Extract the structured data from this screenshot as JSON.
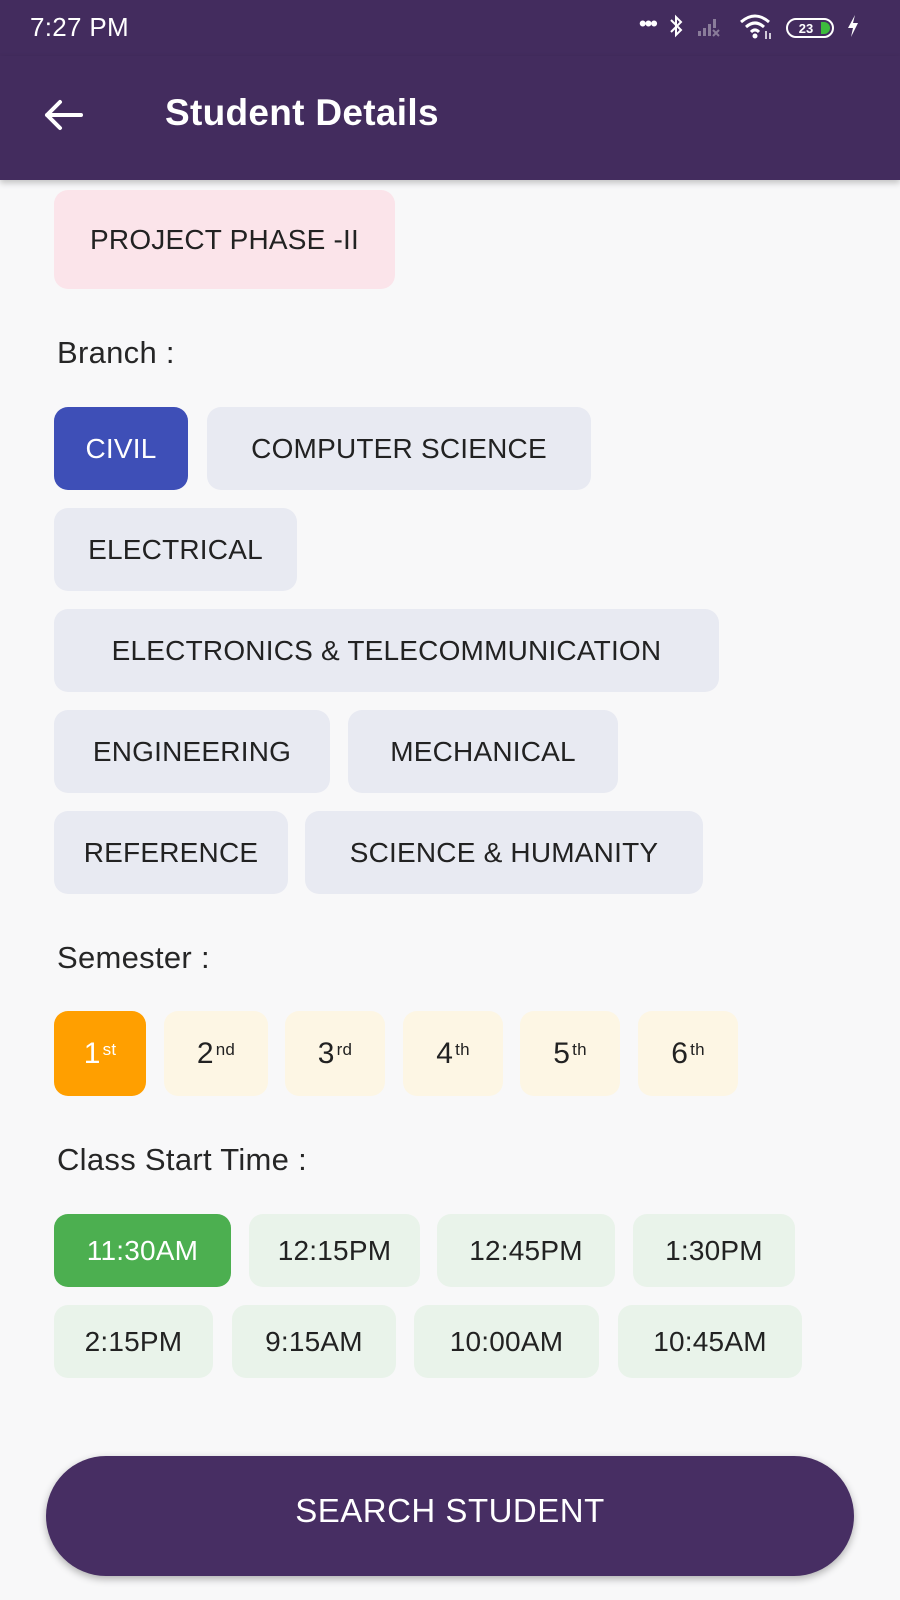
{
  "status_bar": {
    "time": "7:27 PM",
    "battery_level": "23",
    "icons": [
      "more-dots-icon",
      "bluetooth-icon",
      "signal-icon",
      "wifi-icon",
      "battery-icon",
      "charging-icon"
    ]
  },
  "app_bar": {
    "title": "Student Details",
    "back_icon": "arrow-left-icon"
  },
  "subject": {
    "label": "PROJECT PHASE -II"
  },
  "branch": {
    "label": "Branch :",
    "selected": "CIVIL",
    "options": [
      "CIVIL",
      "COMPUTER SCIENCE",
      "ELECTRICAL",
      "ELECTRONICS & TELECOMMUNICATION",
      "ENGINEERING",
      "MECHANICAL",
      "REFERENCE",
      "SCIENCE & HUMANITY"
    ]
  },
  "semester": {
    "label": "Semester :",
    "selected": "1st",
    "options": [
      {
        "num": "1",
        "suffix": "st"
      },
      {
        "num": "2",
        "suffix": "nd"
      },
      {
        "num": "3",
        "suffix": "rd"
      },
      {
        "num": "4",
        "suffix": "th"
      },
      {
        "num": "5",
        "suffix": "th"
      },
      {
        "num": "6",
        "suffix": "th"
      }
    ]
  },
  "class_time": {
    "label": "Class Start Time :",
    "selected": "11:30AM",
    "options": [
      "11:30AM",
      "12:15PM",
      "12:45PM",
      "1:30PM",
      "2:15PM",
      "9:15AM",
      "10:00AM",
      "10:45AM"
    ]
  },
  "search_button": {
    "label": "SEARCH STUDENT"
  },
  "colors": {
    "app_bar": "#432c5e",
    "branch_selected": "#3e4fb7",
    "semester_selected": "#ff9f00",
    "time_selected": "#4caf50",
    "subject_chip": "#fbe4ea"
  }
}
